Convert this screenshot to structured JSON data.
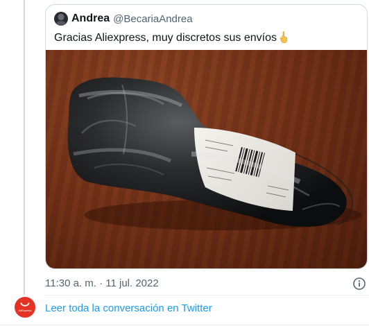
{
  "quoted_tweet": {
    "author_name": "Andrea",
    "author_handle": "@BecariaAndrea",
    "text": "Gracias Aliexpress, muy discretos sus envíos",
    "emoji": "backhand-index-pointing-up",
    "media_description_icon": "package-photo"
  },
  "tweet": {
    "timestamp": "11:30 a. m. · 11 jul. 2022"
  },
  "footer": {
    "logo_label": "AliExpress",
    "read_link": "Leer toda la conversación en Twitter"
  },
  "colors": {
    "link": "#1d9bf0",
    "secondary_text": "#536471",
    "border": "#cfd9de",
    "logo": "#e43225"
  }
}
